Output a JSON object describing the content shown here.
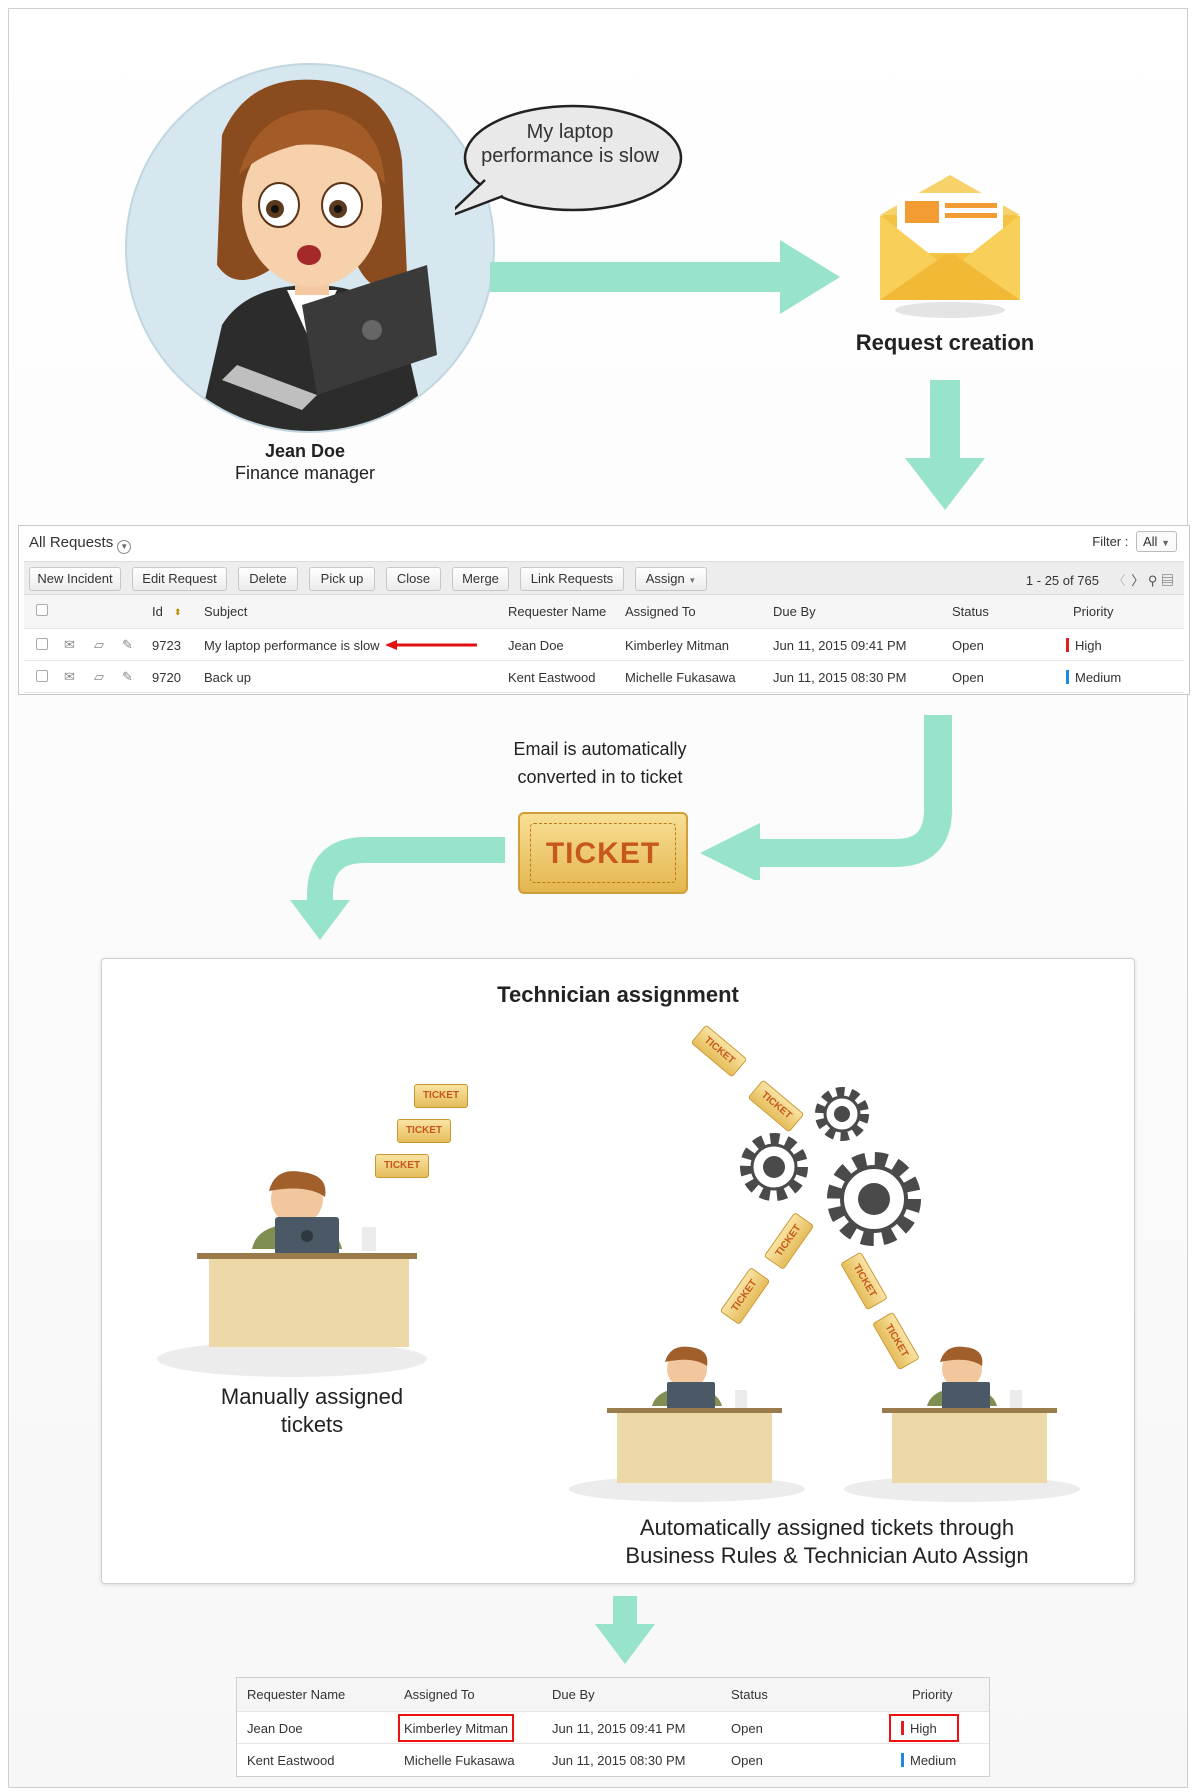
{
  "bubble": {
    "text": "My laptop performance is slow"
  },
  "person": {
    "name": "Jean Doe",
    "role": "Finance manager"
  },
  "steps": {
    "request_creation": "Request creation",
    "conversion": "Email is automatically converted in to ticket",
    "ticket_label": "TICKET",
    "technician_assignment": "Technician assignment",
    "manual": "Manually assigned tickets",
    "automatic": "Automatically assigned tickets through Business Rules & Technician Auto Assign"
  },
  "requests_panel": {
    "title": "All Requests",
    "filter_label": "Filter :",
    "filter_value": "All",
    "toolbar": [
      "New Incident",
      "Edit Request",
      "Delete",
      "Pick up",
      "Close",
      "Merge",
      "Link Requests",
      "Assign"
    ],
    "pager": "1 - 25 of 765",
    "columns": [
      "Id",
      "Subject",
      "Requester Name",
      "Assigned To",
      "Due By",
      "Status",
      "Priority"
    ],
    "rows": [
      {
        "id": "9723",
        "subject": "My laptop performance is slow",
        "requester": "Jean Doe",
        "assigned": "Kimberley Mitman",
        "due": "Jun 11, 2015 09:41 PM",
        "status": "Open",
        "priority": "High",
        "priority_color": "#e02020"
      },
      {
        "id": "9720",
        "subject": "Back up",
        "requester": "Kent Eastwood",
        "assigned": "Michelle Fukasawa",
        "due": "Jun 11, 2015 08:30 PM",
        "status": "Open",
        "priority": "Medium",
        "priority_color": "#1e88e5"
      }
    ]
  },
  "result_table": {
    "columns": [
      "Requester Name",
      "Assigned To",
      "Due By",
      "Status",
      "Priority"
    ],
    "rows": [
      {
        "requester": "Jean Doe",
        "assigned": "Kimberley Mitman",
        "due": "Jun 11, 2015 09:41 PM",
        "status": "Open",
        "priority": "High",
        "priority_color": "#e02020"
      },
      {
        "requester": "Kent Eastwood",
        "assigned": "Michelle Fukasawa",
        "due": "Jun 11, 2015 08:30 PM",
        "status": "Open",
        "priority": "Medium",
        "priority_color": "#1e88e5"
      }
    ]
  },
  "colors": {
    "arrow": "#97e3cc",
    "highlight": "#e11111"
  },
  "icons": [
    "envelope-icon",
    "ticket-icon",
    "gear-icon",
    "technician-icon",
    "desk-icon",
    "laptop-icon"
  ]
}
